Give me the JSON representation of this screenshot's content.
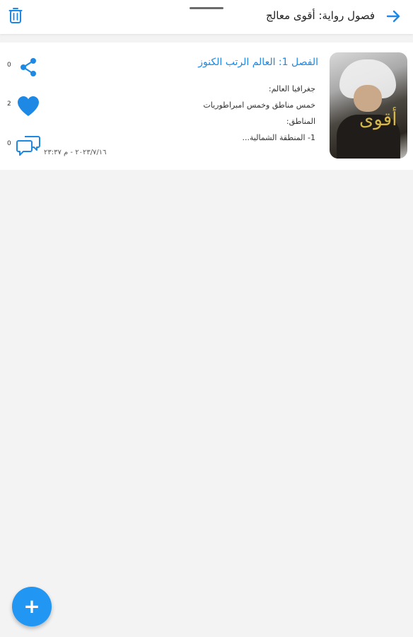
{
  "header": {
    "title": "فصول رواية: أقوى معالج",
    "back_icon": "arrow-right-icon",
    "delete_icon": "trash-icon"
  },
  "chapter": {
    "title": "الفصل 1: العالم الرتب الكنوز",
    "excerpt_lines": [
      "جغرافيا العالم:",
      "خمس مناطق وخمس امبراطوريات",
      "المناطق:",
      "1- المنطقة الشمالية..."
    ],
    "date": "٢٠٢٣/٧/١٦ - م ٢٣:٣٧",
    "shares": "0",
    "likes": "2",
    "comments": "0",
    "cover_text": "أقوى"
  },
  "fab": {
    "label": "+"
  },
  "colors": {
    "accent": "#2196f3",
    "link": "#1e88e5",
    "background": "#f3f3f3"
  }
}
